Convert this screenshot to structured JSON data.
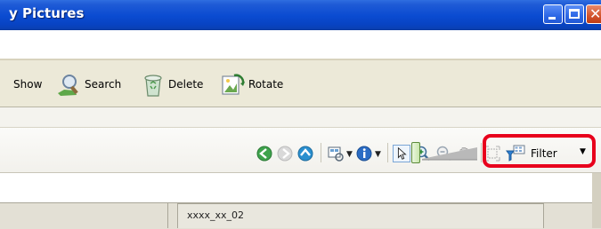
{
  "window": {
    "title": "y Pictures"
  },
  "toolbar": {
    "show_label": "Show",
    "search_label": "Search",
    "delete_label": "Delete",
    "rotate_label": "Rotate"
  },
  "viewer": {
    "filter_label": "Filter"
  },
  "content": {
    "items": [
      {
        "name": "xxxx_xx_02"
      }
    ]
  },
  "colors": {
    "title_bar": "#0a4bd1",
    "highlight": "#e8001c"
  }
}
